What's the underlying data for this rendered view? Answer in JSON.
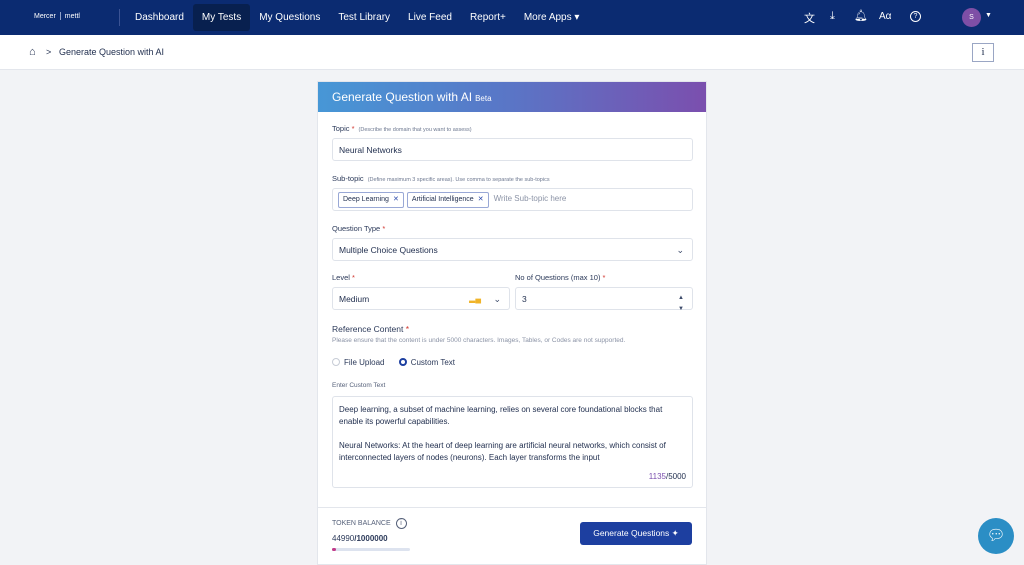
{
  "nav": {
    "brand": "Mercer",
    "brand2": "mettl",
    "items": [
      "Dashboard",
      "My Tests",
      "My Questions",
      "Test Library",
      "Live Feed",
      "Report+",
      "More Apps ▾"
    ],
    "active": "My Tests",
    "font_icon": "Aα",
    "avatar": "S"
  },
  "breadcrumb": {
    "separator": ">",
    "title": "Generate Question with AI",
    "info": "i"
  },
  "form": {
    "title": "Generate Question with AI",
    "badge": "Beta",
    "topic_label": "Topic",
    "topic_hint": "(Describe the domain that you want to assess)",
    "topic_value": "Neural Networks",
    "subtopic_label": "Sub-topic",
    "subtopic_hint": "(Define maximum 3 specific areas). Use comma to separate the sub-topics",
    "subtopics": [
      "Deep Learning",
      "Artificial Intelligence"
    ],
    "subtopic_placeholder": "Write Sub-topic here",
    "qtype_label": "Question Type",
    "qtype_value": "Multiple Choice Questions",
    "level_label": "Level",
    "level_value": "Medium",
    "count_label": "No of Questions (max 10)",
    "count_value": "3",
    "ref_label": "Reference Content",
    "ref_hint": "Please ensure that the content is under 5000 characters. Images, Tables, or Codes are not supported.",
    "radio_file": "File Upload",
    "radio_custom": "Custom Text",
    "selected": "Custom Text",
    "custom_label": "Enter Custom Text",
    "custom_text": "Deep learning, a subset of machine learning, relies on several core foundational blocks that enable its powerful capabilities.\n\nNeural Networks: At the heart of deep learning are artificial neural networks, which consist of interconnected layers of nodes (neurons). Each layer transforms the input",
    "char_count": "1135",
    "char_max": "/5000",
    "token_label": "TOKEN BALANCE",
    "token_used": "44990",
    "token_total": "/1000000",
    "token_fraction": 0.045,
    "generate": "Generate Questions"
  },
  "colors": {
    "nav": "#0b2b71",
    "primary": "#1d3fa0",
    "accent": "#7b4fae"
  }
}
